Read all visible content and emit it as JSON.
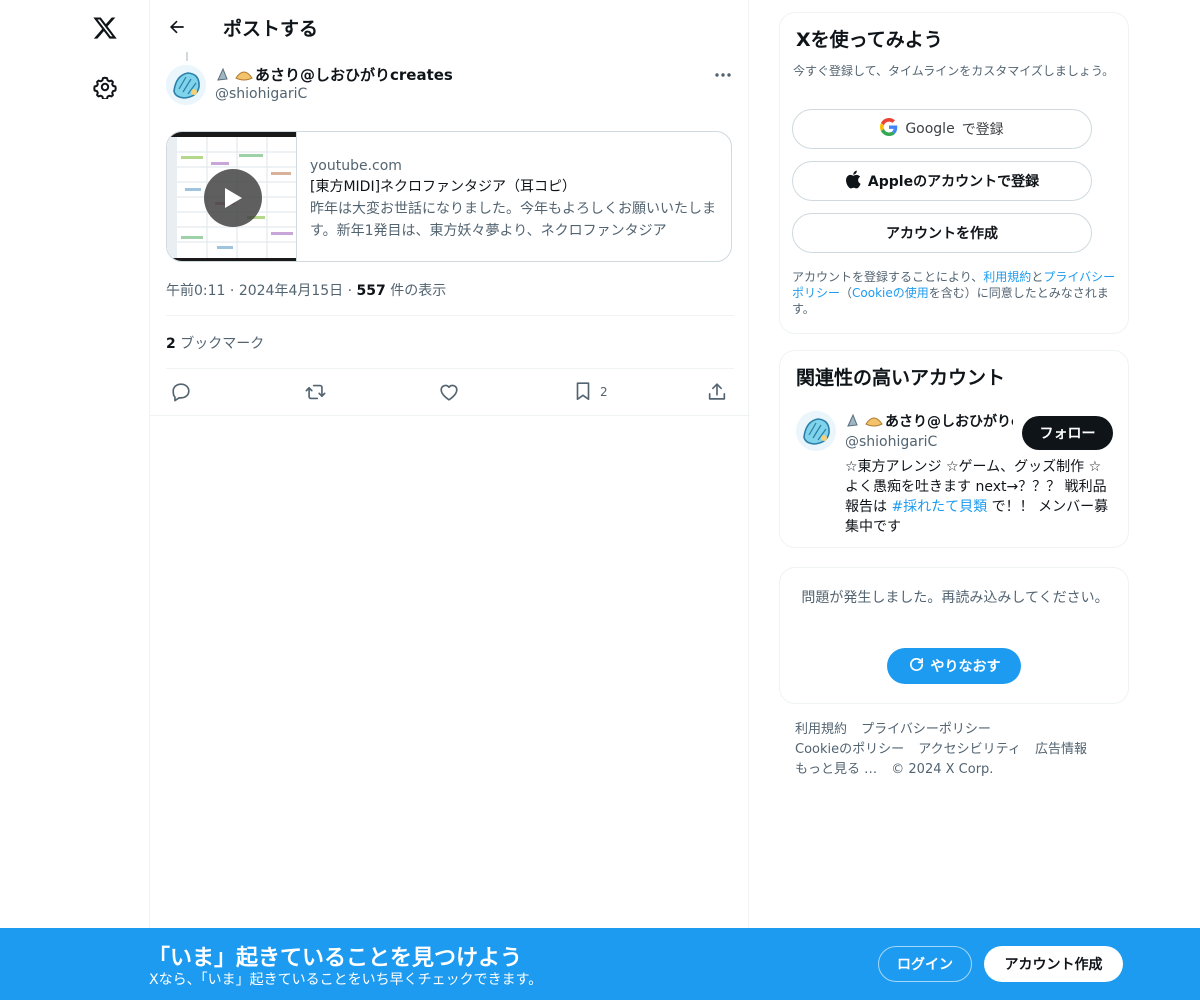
{
  "header": {
    "title": "ポストする"
  },
  "post": {
    "author_name": "あさり@しおひがりcreates",
    "author_handle": "@shiohigariC",
    "card": {
      "domain": "youtube.com",
      "title": "[東方MIDI]ネクロファンタジア（耳コピ）",
      "description": "昨年は大変お世話になりました。今年もよろしくお願いいたします。新年1発目は、東方妖々夢より、ネクロファンタジア"
    },
    "time": "午前0:11",
    "date": "2024年4月15日",
    "separator": "·",
    "view_count": "557",
    "view_label": "件の表示",
    "bookmark_count": "2",
    "bookmark_label": "ブックマーク",
    "actions": {
      "bookmark_count": "2"
    }
  },
  "signup": {
    "title": "Xを使ってみよう",
    "description": "今すぐ登録して、タイムラインをカスタマイズしましょう。",
    "google_brand": "Google",
    "google_label": "で登録",
    "apple_label": "Appleのアカウントで登録",
    "create_label": "アカウントを作成",
    "terms_pre": "アカウントを登録することにより、",
    "terms_link": "利用規約",
    "terms_and": "と",
    "privacy_link": "プライバシーポリシー",
    "terms_paren_open": "（",
    "cookie_link": "Cookieの使用",
    "terms_post": "を含む）に同意したとみなされます。"
  },
  "related": {
    "title": "関連性の高いアカウント",
    "name": "あさり@しおひがりcreates",
    "handle": "@shiohigariC",
    "follow_label": "フォロー",
    "bio_pre": "☆東方アレンジ ☆ゲーム、グッズ制作 ☆よく愚痴を吐きます next→？？？ 戦利品報告は ",
    "bio_hashtag": "#採れたて貝類",
    "bio_post": " で！！ メンバー募集中です"
  },
  "error": {
    "message": "問題が発生しました。再読み込みしてください。",
    "retry_label": "やりなおす"
  },
  "footer": {
    "terms": "利用規約",
    "privacy": "プライバシーポリシー",
    "cookie": "Cookieのポリシー",
    "accessibility": "アクセシビリティ",
    "ads": "広告情報",
    "more": "もっと見る …",
    "copyright": "© 2024 X Corp."
  },
  "banner": {
    "title": "「いま」起きていることを見つけよう",
    "subtitle": "Xなら、「いま」起きていることをいち早くチェックできます。",
    "login_label": "ログイン",
    "create_label": "アカウント作成"
  },
  "colors": {
    "accent": "#1d9bf0",
    "text_primary": "#0f1419",
    "text_secondary": "#536471",
    "border": "#eff3f4"
  }
}
